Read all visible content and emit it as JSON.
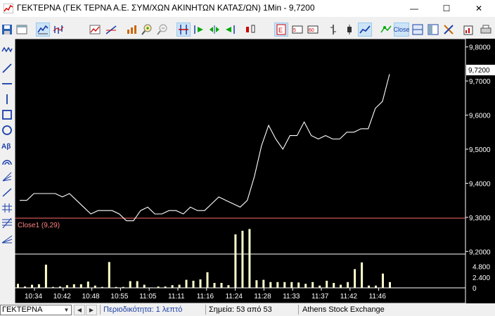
{
  "window": {
    "title": "ΓΕΚΤΕΡΝΑ (ΓΕΚ ΤΕΡΝΑ Α.Ε. ΣΥΜ/ΧΩΝ ΑΚΙΝΗΤΩΝ ΚΑΤΑΣ/ΩΝ) 1Min - 9,7200",
    "minimize": "—",
    "maximize": "☐",
    "close": "✕"
  },
  "toolbar": {
    "close_label": "Close"
  },
  "statusbar": {
    "symbol": "ΓΕΚΤΕΡΝΑ",
    "period": "Περιοδικότητα: 1 λεπτό",
    "points": "Σημεία: 53 από 53",
    "exchange": "Athens Stock Exchange"
  },
  "colors": {
    "background": "#000000",
    "price_line": "#ffffff",
    "volume_bars": "#ffffcc",
    "separator": "#ff6b6b",
    "indicator_label": "#ff8080",
    "axis_text": "#ffffff"
  },
  "chart_data": [
    {
      "type": "line",
      "series": [
        {
          "values": [
            9.35,
            9.35,
            9.37,
            9.37,
            9.37,
            9.37,
            9.36,
            9.37,
            9.35,
            9.33,
            9.31,
            9.32,
            9.32,
            9.32,
            9.31,
            9.29,
            9.29,
            9.32,
            9.33,
            9.31,
            9.31,
            9.32,
            9.32,
            9.31,
            9.33,
            9.32,
            9.32,
            9.34,
            9.36,
            9.35,
            9.34,
            9.33,
            9.35,
            9.42,
            9.51,
            9.57,
            9.53,
            9.5,
            9.54,
            9.54,
            9.58,
            9.54,
            9.53,
            9.54,
            9.53,
            9.53,
            9.55,
            9.55,
            9.56,
            9.56,
            9.62,
            9.64,
            9.72
          ]
        }
      ],
      "x_ticks": [
        "10:34",
        "10:42",
        "10:48",
        "10:55",
        "11:05",
        "11:11",
        "11:16",
        "11:24",
        "11:28",
        "11:33",
        "11:37",
        "11:42",
        "11:46"
      ],
      "y_ticks": [
        "9,8000",
        "9,7000",
        "9,6000",
        "9,5000",
        "9,4000",
        "9,3000",
        "9,2000"
      ],
      "ylim": [
        9.18,
        9.82
      ],
      "last_value_label": "9,7200",
      "grid": false
    },
    {
      "type": "bar",
      "title": "Close1 (9,29)",
      "values": [
        900,
        300,
        700,
        800,
        5200,
        200,
        300,
        600,
        800,
        800,
        1400,
        500,
        200,
        5800,
        200,
        200,
        1500,
        1500,
        700,
        100,
        300,
        300,
        600,
        700,
        1800,
        1600,
        1900,
        3500,
        1100,
        1100,
        600,
        12000,
        12800,
        13200,
        1700,
        1800,
        1300,
        1300,
        1300,
        1300,
        1200,
        900,
        1300,
        500,
        1600,
        1100,
        700,
        1300,
        4200,
        5700,
        500,
        500,
        3200,
        1300
      ],
      "y_ticks": [
        "4.800",
        "2.400",
        "0"
      ],
      "ylim": [
        0,
        6000
      ],
      "grid": false
    }
  ]
}
